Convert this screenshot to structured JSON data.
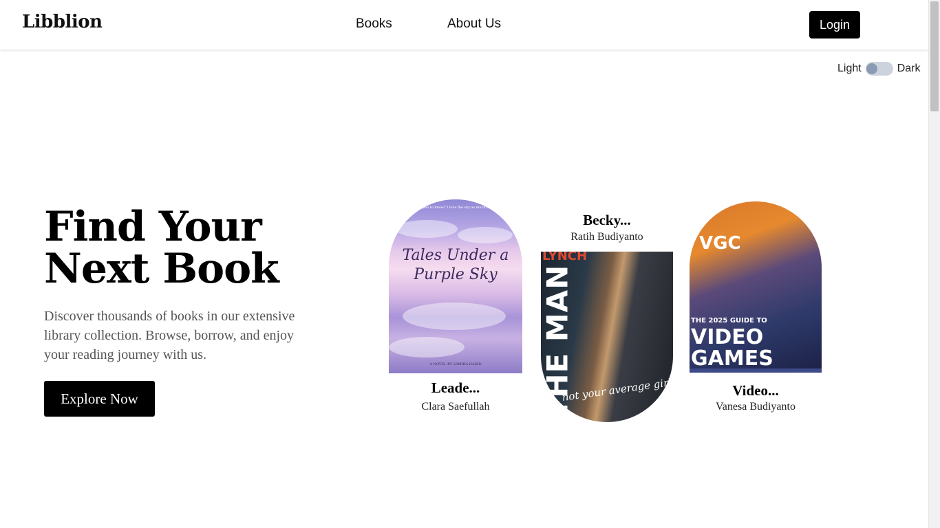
{
  "header": {
    "logo": "Libblion",
    "nav": [
      {
        "label": "Books"
      },
      {
        "label": "About Us"
      }
    ],
    "login_label": "Login"
  },
  "theme_toggle": {
    "light_label": "Light",
    "dark_label": "Dark",
    "state": "light"
  },
  "hero": {
    "title_line1": "Find Your",
    "title_line2": "Next Book",
    "description": "Discover thousands of books in our extensive library collection. Browse, borrow, and enjoy your reading journey with us.",
    "cta_label": "Explore Now"
  },
  "books": [
    {
      "title": "Leade...",
      "author": "Clara Saefullah",
      "cover_text": {
        "tagline": "Did you happen to know? I love the sky as much as I love you.",
        "title": "Tales Under a Purple Sky",
        "byline": "A NOVEL BY SAMIRA HADID"
      }
    },
    {
      "title": "Becky...",
      "author": "Ratih Budiyanto",
      "cover_text": {
        "top": "LYNCH",
        "title": "THE MAN",
        "tagline": "not your average girl"
      }
    },
    {
      "title": "Video...",
      "author": "Vanesa Budiyanto",
      "cover_text": {
        "brand": "VGC",
        "subtitle": "THE 2025 GUIDE TO",
        "title": "VIDEO GAMES"
      }
    }
  ],
  "colors": {
    "primary_button": "#000000",
    "toggle_track": "#cdd3dc",
    "toggle_knob": "#8c9ab5",
    "description_text": "#555555"
  }
}
